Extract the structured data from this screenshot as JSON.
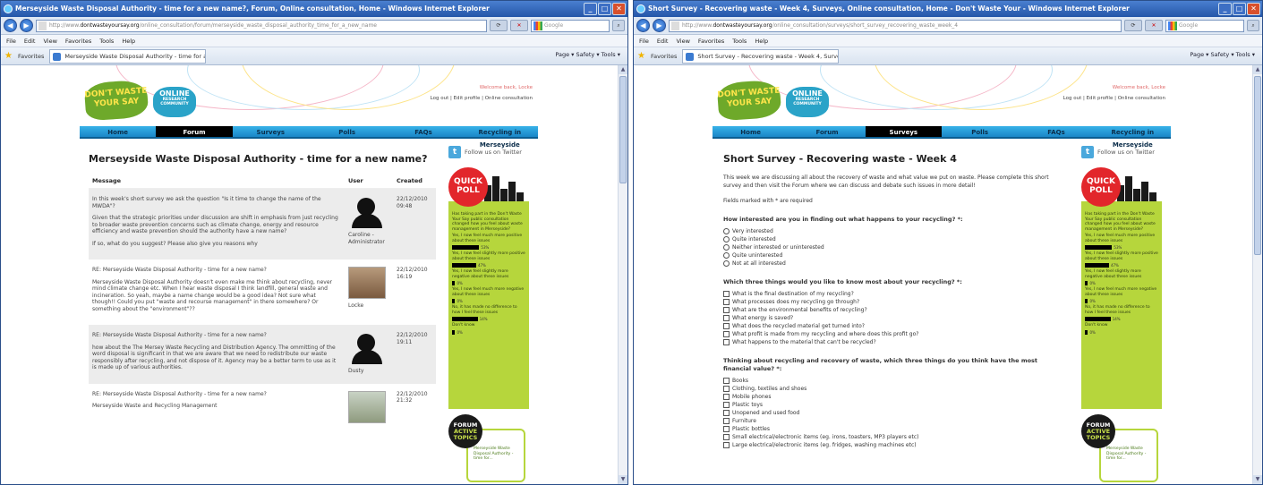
{
  "left_window": {
    "title": "Merseyside Waste Disposal Authority - time for a new name?, Forum, Online consultation, Home - Windows Internet Explorer",
    "url_prefix": "http://www.",
    "url_domain": "dontwasteyoursay.org",
    "url_rest": "/online_consultation/forum/merseyside_waste_disposal_authority_time_for_a_new_name",
    "search_placeholder": "Google",
    "menu": [
      "File",
      "Edit",
      "View",
      "Favorites",
      "Tools",
      "Help"
    ],
    "favorites_label": "Favorites",
    "tab_title": "Merseyside Waste Disposal Authority - time for a new...",
    "toolbar_right": "Page ▾  Safety ▾  Tools ▾",
    "site": {
      "logo_left": "DON'T WASTE YOUR SAY",
      "logo_right": "ONLINE",
      "logo_right_small": "RESEARCH COMMUNITY",
      "welcome": "Welcome back, Locke",
      "top_links": "Log out  |  Edit profile  |  Online consultation",
      "nav": [
        "Home",
        "Forum",
        "Surveys",
        "Polls",
        "FAQs",
        "Recycling in Merseyside"
      ],
      "active_nav": "Forum"
    },
    "heading": "Merseyside Waste Disposal Authority - time for a new name?",
    "columns": {
      "message": "Message",
      "user": "User",
      "created": "Created"
    },
    "posts": [
      {
        "paragraphs": [
          "In this week's short survey we ask the question \"Is it time to change the name of the MWDA\"?",
          "Given that the strategic priorities under discussion are shift in emphasis from just recycling to broader waste prevention concerns such as climate change, energy and resource efficiency and waste prevention should the authority have a new name?",
          "If so, what do you suggest? Please also give you reasons why"
        ],
        "user": "Caroline - Administrator",
        "date": "22/12/2010",
        "time": "09:48",
        "avatar": "silhouette"
      },
      {
        "paragraphs": [
          "RE: Merseyside Waste Disposal Authority - time for a new name?",
          "Merseyside Waste Disposal Authority doesn't even make me think about recycling, never mind climate change etc. When I hear waste disposal I think landfill, general waste and incineration. So yeah, maybe a name change would be a good idea? Not sure what though!! Could you put \"waste and recourse management\" in there somewhere? Or something about the \"environment\"??"
        ],
        "user": "Locke",
        "date": "22/12/2010",
        "time": "16:19",
        "avatar": "photo"
      },
      {
        "paragraphs": [
          "RE: Merseyside Waste Disposal Authority - time for a new name?",
          "how about the The Mersey Waste Recycling and Distribution Agency. The ommitting of the word disposal is significant in that we are aware that we need to redistribute our waste responsibly after recycling, and not dispose of it. Agency may be a better term to use as it is made up of various authorities."
        ],
        "user": "Dusty",
        "date": "22/12/2010",
        "time": "19:11",
        "avatar": "silhouette"
      },
      {
        "paragraphs": [
          "RE: Merseyside Waste Disposal Authority - time for a new name?",
          "Merseyside Waste and Recycling Management"
        ],
        "user": "",
        "date": "22/12/2010",
        "time": "21:32",
        "avatar": "photo2"
      }
    ]
  },
  "right_window": {
    "title": "Short Survey - Recovering waste - Week 4, Surveys, Online consultation, Home - Don't Waste Your - Windows Internet Explorer",
    "url_prefix": "http://www.",
    "url_domain": "dontwasteyoursay.org",
    "url_rest": "/online_consultation/surveys/short_survey_recovering_waste_week_4",
    "search_placeholder": "Google",
    "menu": [
      "File",
      "Edit",
      "View",
      "Favorites",
      "Tools",
      "Help"
    ],
    "favorites_label": "Favorites",
    "tab_title": "Short Survey - Recovering waste - Week 4, Surveys, ...",
    "toolbar_right": "Page ▾  Safety ▾  Tools ▾",
    "site": {
      "logo_left": "DON'T WASTE YOUR SAY",
      "logo_right": "ONLINE",
      "logo_right_small": "RESEARCH COMMUNITY",
      "welcome": "Welcome back, Locke",
      "top_links": "Log out  |  Edit profile  |  Online consultation",
      "nav": [
        "Home",
        "Forum",
        "Surveys",
        "Polls",
        "FAQs",
        "Recycling in Merseyside"
      ],
      "active_nav": "Surveys"
    },
    "heading": "Short Survey - Recovering waste - Week 4",
    "intro": "This week we are discussing all about the recovery of waste and what value we put on waste. Please complete this short survey and then visit the Forum where we can discuss and debate such issues in more detail!",
    "required_note": "Fields marked with * are required",
    "q1": {
      "label": "How interested are you in finding out what happens to your recycling? *:",
      "options": [
        "Very interested",
        "Quite interested",
        "Neither interested or uninterested",
        "Quite uninterested",
        "Not at all interested"
      ]
    },
    "q2": {
      "label": "Which three things would you like to know most about your recycling? *:",
      "options": [
        "What is the final destination of my recycling?",
        "What processes does my recycling go through?",
        "What are the environmental benefits of recycling?",
        "What energy is saved?",
        "What does the recycled material get turned into?",
        "What profit is made from my recycling and where does this profit go?",
        "What happens to the material that can't be recycled?"
      ]
    },
    "q3": {
      "label": "Thinking about recycling and recovery of waste, which three things do you think have the most financial value? *:",
      "options": [
        "Books",
        "Clothing, textiles and shoes",
        "Mobile phones",
        "Plastic toys",
        "Unopened and used food",
        "Furniture",
        "Plastic bottles",
        "Small electrical/electronic items (eg. irons, toasters, MP3 players etc)",
        "Large electrical/electronic items (eg. fridges, washing machines etc)"
      ]
    }
  },
  "sidebar": {
    "twitter": "Follow us on Twitter",
    "quick_poll": "QUICK POLL",
    "poll_question": "Has taking part in the Don't Waste Your Say public consultation changed how you feel about waste management in Merseyside?",
    "poll_options": [
      {
        "text": "Yes, I now feel much more positive about these issues",
        "value": "53%",
        "fraction": 0.53
      },
      {
        "text": "Yes, I now feel slightly more positive about these issues",
        "value": "47%",
        "fraction": 0.47
      },
      {
        "text": "Yes, I now feel slightly more negative about these issues",
        "value": "0%",
        "fraction": 0.06
      },
      {
        "text": "Yes, I now feel much more negative about these issues",
        "value": "0%",
        "fraction": 0.06
      },
      {
        "text": "No, it has made no difference to how I feel these issues",
        "value": "14%",
        "fraction": 0.5
      },
      {
        "text": "Don't know",
        "value": "0%",
        "fraction": 0.06
      }
    ],
    "forum": "FORUM",
    "active": "ACTIVE",
    "topics": "TOPICS",
    "forum_topic": "Merseyside Waste Disposal Authority - time for..."
  }
}
